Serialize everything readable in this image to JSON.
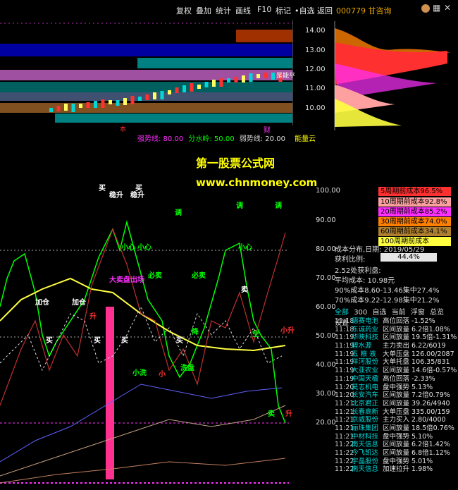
{
  "menu": {
    "items": [
      "复权",
      "叠加",
      "统计",
      "画线",
      "F10",
      "标记",
      "•自选",
      "返回"
    ],
    "stock_code": "000779 甘咨询"
  },
  "price_axis": {
    "ticks": [
      "14.00",
      "13.00",
      "12.00",
      "11.00",
      "10.00"
    ]
  },
  "top_chart": {
    "labels": {
      "cap": "是能平",
      "cai": "财",
      "dot": "本"
    }
  },
  "legend_line": {
    "strong": "强势线: 80.00",
    "mid": "分水岭: 50.00",
    "weak": "弱势线: 20.00",
    "tail": "能量云"
  },
  "watermark": {
    "title": "第一股票公式网",
    "url": "www.chnmoney.com"
  },
  "indicator_axis": {
    "ticks": [
      "100.00",
      "90.00",
      "80.00",
      "70.00",
      "60.00",
      "50.00",
      "40.00",
      "30.00",
      "20.00"
    ]
  },
  "annotations": {
    "buy1": "买",
    "buy2": "买",
    "stable1": "稳升",
    "stable2": "稳升",
    "adjust": "调",
    "adjust2": "调",
    "adjust3": "调",
    "careful": "小心",
    "careful2": "小心",
    "careful3": "小心",
    "add1": "加仓",
    "add2": "加仓",
    "sell": "必卖",
    "sell2": "必卖",
    "big_sell": "大卖盘出场",
    "buy3": "买",
    "buy4": "买",
    "buy5": "买",
    "buy6": "买",
    "rise": "升",
    "small_rise": "小升",
    "wash": "洗盘",
    "drop": "降",
    "sell3": "卖",
    "sell4": "卖",
    "empty": "空",
    "small_wash": "小洗",
    "smalla": "小",
    "rise2": "升"
  },
  "cost_boxes": [
    {
      "label": "5周期前成本96.5%",
      "color": "#ff3030"
    },
    {
      "label": "10周期前成本92.8%",
      "color": "#ffa0a0"
    },
    {
      "label": "20周期前成本85.2%",
      "color": "#ff30ff"
    },
    {
      "label": "30周期前成本74.0%",
      "color": "#ff8000"
    },
    {
      "label": "60周期前成本34.1%",
      "color": "#b08030"
    },
    {
      "label": "100周期前成本22.2%",
      "color": "#ffff40"
    }
  ],
  "info": {
    "dist_date_label": "成本分布,日期: 2019/05/29",
    "profit_label": "获利比例:",
    "profit_value": "44.4%",
    "profit_line": "2.52处获利盘:",
    "avg_cost": "平均成本: 10.98元",
    "cost90": "90%成本8.60-13.46集中27.4%",
    "cost70": "70%成本9.22-12.98集中21.2%"
  },
  "watch_tabs": [
    "全部",
    "300",
    "自选",
    "当前",
    "浮窗",
    "总览",
    "设置"
  ],
  "watch_list": [
    {
      "time": "11:18",
      "name": "德赛电池",
      "desc": "高位回落 -1.52%"
    },
    {
      "time": "11:18",
      "name": "东诚药业",
      "desc": "区间放量 6.2倍1.08%"
    },
    {
      "time": "11:19",
      "name": "华映科技",
      "desc": "区间放量 19.5倍-1.31%"
    },
    {
      "time": "11:19",
      "name": "碧水源",
      "desc": "主力卖出 6.22/6019"
    },
    {
      "time": "11:19",
      "name": "五 粮 液",
      "desc": "大单压盘 126.00/2087"
    },
    {
      "time": "11:19",
      "name": "洋河股份",
      "desc": "大单托盘 106.35/831"
    },
    {
      "time": "11:19",
      "name": "大亚农业",
      "desc": "区间放量 14.6倍-0.57%"
    },
    {
      "time": "11:19",
      "name": "中国天楹",
      "desc": "高位回落 -2.33%"
    },
    {
      "time": "11:20",
      "name": "昊志机电",
      "desc": "盘中强势 5.13%"
    },
    {
      "time": "11:20",
      "name": "长安汽车",
      "desc": "区间放量 7.2倍0.79%"
    },
    {
      "time": "11:21",
      "name": "北京君正",
      "desc": "区间放量 39.26/4940"
    },
    {
      "time": "11:21",
      "name": "长春高新",
      "desc": "大单压盘 335.00/159"
    },
    {
      "time": "11:21",
      "name": "京威股份",
      "desc": "主力买入 2.80/4000"
    },
    {
      "time": "11:21",
      "name": "丽珠集团",
      "desc": "区间放量 18.5倍0.76%"
    },
    {
      "time": "11:21",
      "name": "中材科技",
      "desc": "盘中强势 5.10%"
    },
    {
      "time": "11:22",
      "name": "南天信息",
      "desc": "区间放量 6.2倍1.42%"
    },
    {
      "time": "11:22",
      "name": "今飞凯达",
      "desc": "区间放量 6.8倍1.12%"
    },
    {
      "time": "11:22",
      "name": "宇晶股份",
      "desc": "盘中强势 5.01%"
    },
    {
      "time": "11:22",
      "name": "南天信息",
      "desc": "加速拉升 1.98%"
    }
  ],
  "colors": {
    "accent": "#ffff00",
    "up": "#ff3030",
    "down": "#00d8d8",
    "strong": "#ff30ff",
    "mid": "#00ff00"
  }
}
